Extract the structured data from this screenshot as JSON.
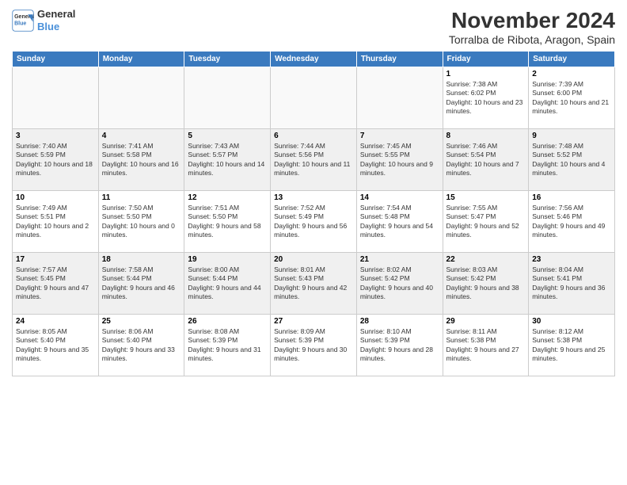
{
  "header": {
    "logo_line1": "General",
    "logo_line2": "Blue",
    "month_title": "November 2024",
    "subtitle": "Torralba de Ribota, Aragon, Spain"
  },
  "weekdays": [
    "Sunday",
    "Monday",
    "Tuesday",
    "Wednesday",
    "Thursday",
    "Friday",
    "Saturday"
  ],
  "weeks": [
    [
      {
        "day": "",
        "info": ""
      },
      {
        "day": "",
        "info": ""
      },
      {
        "day": "",
        "info": ""
      },
      {
        "day": "",
        "info": ""
      },
      {
        "day": "",
        "info": ""
      },
      {
        "day": "1",
        "info": "Sunrise: 7:38 AM\nSunset: 6:02 PM\nDaylight: 10 hours and 23 minutes."
      },
      {
        "day": "2",
        "info": "Sunrise: 7:39 AM\nSunset: 6:00 PM\nDaylight: 10 hours and 21 minutes."
      }
    ],
    [
      {
        "day": "3",
        "info": "Sunrise: 7:40 AM\nSunset: 5:59 PM\nDaylight: 10 hours and 18 minutes."
      },
      {
        "day": "4",
        "info": "Sunrise: 7:41 AM\nSunset: 5:58 PM\nDaylight: 10 hours and 16 minutes."
      },
      {
        "day": "5",
        "info": "Sunrise: 7:43 AM\nSunset: 5:57 PM\nDaylight: 10 hours and 14 minutes."
      },
      {
        "day": "6",
        "info": "Sunrise: 7:44 AM\nSunset: 5:56 PM\nDaylight: 10 hours and 11 minutes."
      },
      {
        "day": "7",
        "info": "Sunrise: 7:45 AM\nSunset: 5:55 PM\nDaylight: 10 hours and 9 minutes."
      },
      {
        "day": "8",
        "info": "Sunrise: 7:46 AM\nSunset: 5:54 PM\nDaylight: 10 hours and 7 minutes."
      },
      {
        "day": "9",
        "info": "Sunrise: 7:48 AM\nSunset: 5:52 PM\nDaylight: 10 hours and 4 minutes."
      }
    ],
    [
      {
        "day": "10",
        "info": "Sunrise: 7:49 AM\nSunset: 5:51 PM\nDaylight: 10 hours and 2 minutes."
      },
      {
        "day": "11",
        "info": "Sunrise: 7:50 AM\nSunset: 5:50 PM\nDaylight: 10 hours and 0 minutes."
      },
      {
        "day": "12",
        "info": "Sunrise: 7:51 AM\nSunset: 5:50 PM\nDaylight: 9 hours and 58 minutes."
      },
      {
        "day": "13",
        "info": "Sunrise: 7:52 AM\nSunset: 5:49 PM\nDaylight: 9 hours and 56 minutes."
      },
      {
        "day": "14",
        "info": "Sunrise: 7:54 AM\nSunset: 5:48 PM\nDaylight: 9 hours and 54 minutes."
      },
      {
        "day": "15",
        "info": "Sunrise: 7:55 AM\nSunset: 5:47 PM\nDaylight: 9 hours and 52 minutes."
      },
      {
        "day": "16",
        "info": "Sunrise: 7:56 AM\nSunset: 5:46 PM\nDaylight: 9 hours and 49 minutes."
      }
    ],
    [
      {
        "day": "17",
        "info": "Sunrise: 7:57 AM\nSunset: 5:45 PM\nDaylight: 9 hours and 47 minutes."
      },
      {
        "day": "18",
        "info": "Sunrise: 7:58 AM\nSunset: 5:44 PM\nDaylight: 9 hours and 46 minutes."
      },
      {
        "day": "19",
        "info": "Sunrise: 8:00 AM\nSunset: 5:44 PM\nDaylight: 9 hours and 44 minutes."
      },
      {
        "day": "20",
        "info": "Sunrise: 8:01 AM\nSunset: 5:43 PM\nDaylight: 9 hours and 42 minutes."
      },
      {
        "day": "21",
        "info": "Sunrise: 8:02 AM\nSunset: 5:42 PM\nDaylight: 9 hours and 40 minutes."
      },
      {
        "day": "22",
        "info": "Sunrise: 8:03 AM\nSunset: 5:42 PM\nDaylight: 9 hours and 38 minutes."
      },
      {
        "day": "23",
        "info": "Sunrise: 8:04 AM\nSunset: 5:41 PM\nDaylight: 9 hours and 36 minutes."
      }
    ],
    [
      {
        "day": "24",
        "info": "Sunrise: 8:05 AM\nSunset: 5:40 PM\nDaylight: 9 hours and 35 minutes."
      },
      {
        "day": "25",
        "info": "Sunrise: 8:06 AM\nSunset: 5:40 PM\nDaylight: 9 hours and 33 minutes."
      },
      {
        "day": "26",
        "info": "Sunrise: 8:08 AM\nSunset: 5:39 PM\nDaylight: 9 hours and 31 minutes."
      },
      {
        "day": "27",
        "info": "Sunrise: 8:09 AM\nSunset: 5:39 PM\nDaylight: 9 hours and 30 minutes."
      },
      {
        "day": "28",
        "info": "Sunrise: 8:10 AM\nSunset: 5:39 PM\nDaylight: 9 hours and 28 minutes."
      },
      {
        "day": "29",
        "info": "Sunrise: 8:11 AM\nSunset: 5:38 PM\nDaylight: 9 hours and 27 minutes."
      },
      {
        "day": "30",
        "info": "Sunrise: 8:12 AM\nSunset: 5:38 PM\nDaylight: 9 hours and 25 minutes."
      }
    ]
  ]
}
